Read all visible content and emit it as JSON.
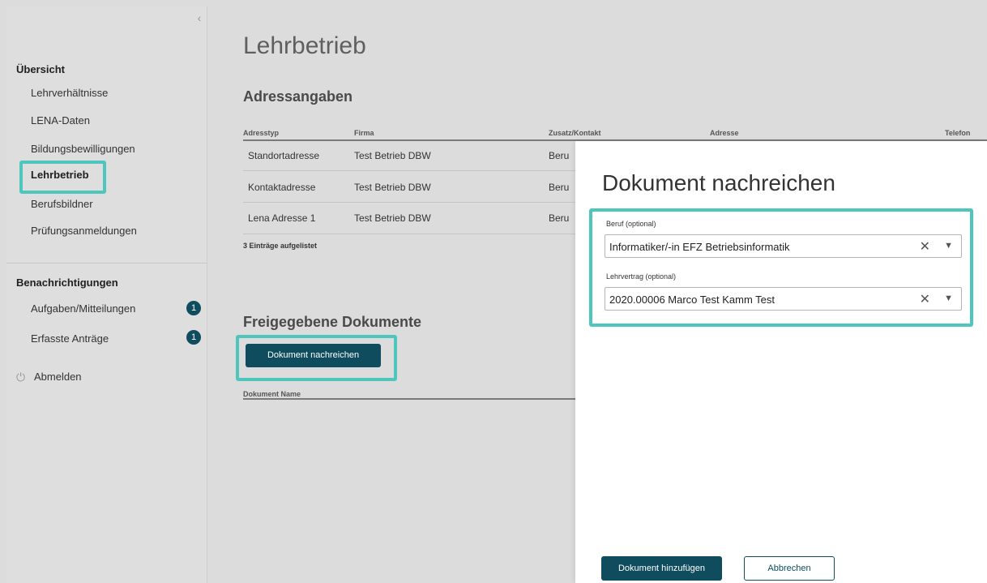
{
  "sidebar": {
    "collapse_icon": "chevron-left-icon",
    "overview_title": "Übersicht",
    "items": [
      {
        "label": "Lehrverhältnisse"
      },
      {
        "label": "LENA-Daten"
      },
      {
        "label": "Bildungsbewilligungen"
      },
      {
        "label": "Lehrbetrieb"
      },
      {
        "label": "Berufsbildner"
      },
      {
        "label": "Prüfungsanmeldungen"
      }
    ],
    "notifications_title": "Benachrichtigungen",
    "notifications": [
      {
        "label": "Aufgaben/Mitteilungen",
        "count": "1"
      },
      {
        "label": "Erfasste Anträge",
        "count": "1"
      }
    ],
    "logout_label": "Abmelden",
    "logout_icon": "power-icon"
  },
  "main": {
    "title": "Lehrbetrieb",
    "address_section": "Adressangaben",
    "table_headers": [
      "Adresstyp",
      "Firma",
      "Zusatz/Kontakt",
      "Adresse",
      "Telefon"
    ],
    "rows": [
      {
        "type": "Standortadresse",
        "firma": "Test Betrieb DBW",
        "kontakt": "Beru"
      },
      {
        "type": "Kontaktadresse",
        "firma": "Test Betrieb DBW",
        "kontakt": "Beru"
      },
      {
        "type": "Lena Adresse 1",
        "firma": "Test Betrieb DBW",
        "kontakt": "Beru"
      }
    ],
    "count_text": "3 Einträge aufgelistet",
    "docs_section": "Freigegebene Dokumente",
    "submit_doc_button": "Dokument nachreichen",
    "doc_table_header": "Dokument Name"
  },
  "panel": {
    "title": "Dokument nachreichen",
    "beruf_label": "Beruf (optional)",
    "beruf_value": "Informatiker/-in EFZ Betriebsinformatik",
    "lehrvertrag_label": "Lehrvertrag (optional)",
    "lehrvertrag_value": "2020.00006  Marco Test Kamm Test",
    "add_button": "Dokument hinzufügen",
    "cancel_button": "Abbrechen"
  },
  "colors": {
    "primary": "#0e4c5e",
    "highlight": "#4fc6bd"
  }
}
